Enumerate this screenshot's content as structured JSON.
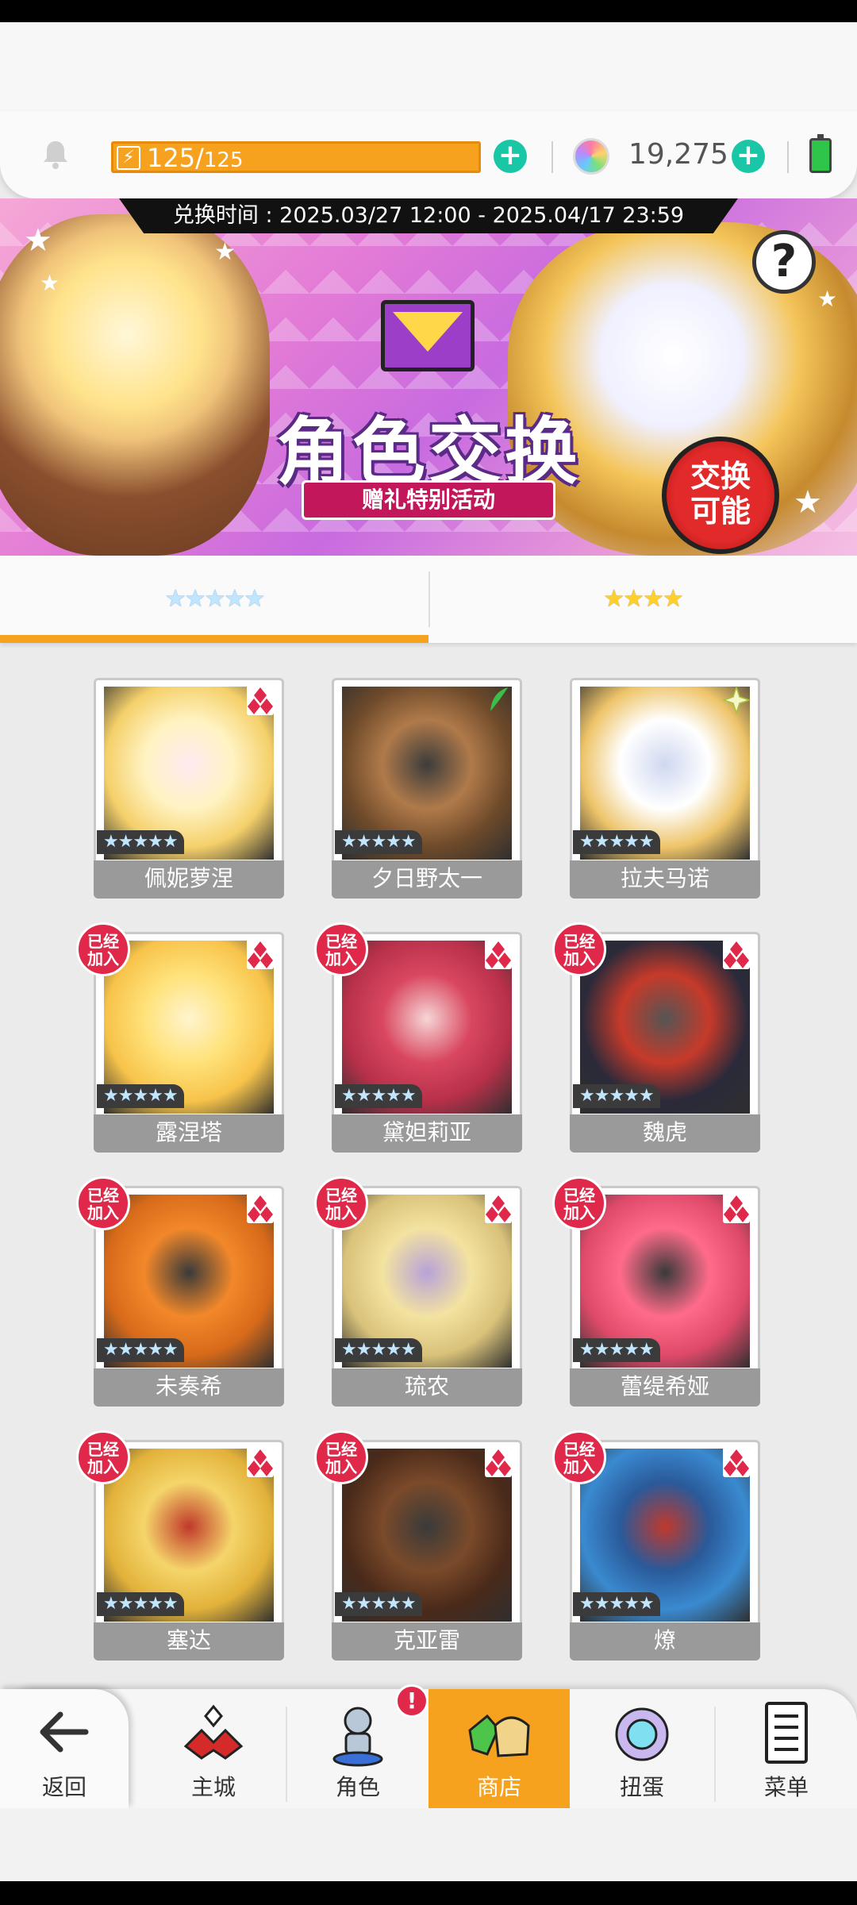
{
  "resources": {
    "stamina_current": "125/",
    "stamina_max": "125",
    "bolt_glyph": "⚡",
    "gems": "19,275"
  },
  "banner": {
    "exchange_period": "兑换时间 : 2025.03/27 12:00 - 2025.04/17 23:59",
    "title": "角色交换",
    "subtitle": "赠礼特别活动",
    "badge": "交换可能",
    "help": "?"
  },
  "tabs": [
    {
      "label": "★★★★★"
    },
    {
      "label": "★★★★"
    }
  ],
  "characters": [
    {
      "name": "佩妮萝涅",
      "stars": "★★★★★",
      "element": "fire",
      "joined": false,
      "palette": [
        "#fff3c2",
        "#f5d06a",
        "#ffe9f1"
      ]
    },
    {
      "name": "夕日野太一",
      "stars": "★★★★★",
      "element": "wind",
      "joined": false,
      "palette": [
        "#b07a4a",
        "#6e4a2a",
        "#3c3c3c"
      ]
    },
    {
      "name": "拉夫马诺",
      "stars": "★★★★★",
      "element": "light",
      "joined": false,
      "palette": [
        "#ffffff",
        "#eec469",
        "#cfd8f0"
      ]
    },
    {
      "name": "露涅塔",
      "stars": "★★★★★",
      "element": "fire",
      "joined": true,
      "palette": [
        "#ffe27a",
        "#f7c34a",
        "#fff4cf"
      ]
    },
    {
      "name": "黛妲莉亚",
      "stars": "★★★★★",
      "element": "fire",
      "joined": true,
      "palette": [
        "#d9475f",
        "#b7304a",
        "#f6d6d6"
      ]
    },
    {
      "name": "魏虎",
      "stars": "★★★★★",
      "element": "fire",
      "joined": true,
      "palette": [
        "#c63a2a",
        "#2a2a3a",
        "#555"
      ]
    },
    {
      "name": "未奏希",
      "stars": "★★★★★",
      "element": "fire",
      "joined": true,
      "palette": [
        "#f2882a",
        "#d76a1a",
        "#3a3a3a"
      ]
    },
    {
      "name": "琉农",
      "stars": "★★★★★",
      "element": "fire",
      "joined": true,
      "palette": [
        "#f3e3a0",
        "#d9c27a",
        "#b7a2d9"
      ]
    },
    {
      "name": "蕾缇希娅",
      "stars": "★★★★★",
      "element": "fire",
      "joined": true,
      "palette": [
        "#ff6b8a",
        "#e04a6a",
        "#3a3a3a"
      ]
    },
    {
      "name": "塞达",
      "stars": "★★★★★",
      "element": "fire",
      "joined": true,
      "palette": [
        "#f5d56a",
        "#e2b23a",
        "#c0392b"
      ]
    },
    {
      "name": "克亚雷",
      "stars": "★★★★★",
      "element": "fire",
      "joined": true,
      "palette": [
        "#7a4a2a",
        "#4a2a1a",
        "#3a3a3a"
      ]
    },
    {
      "name": "燎",
      "stars": "★★★★★",
      "element": "fire",
      "joined": true,
      "palette": [
        "#2a5a9a",
        "#3a8ad0",
        "#c0392b"
      ]
    }
  ],
  "joined_badge": "已经加入",
  "nav": {
    "back": "返回",
    "items": [
      {
        "label": "主城"
      },
      {
        "label": "角色"
      },
      {
        "label": "商店"
      },
      {
        "label": "扭蛋"
      },
      {
        "label": "菜单"
      }
    ],
    "alert": "!"
  },
  "colors": {
    "accent": "#f6a21f",
    "plus": "#19c6a6",
    "badge_red": "#e0284a"
  }
}
